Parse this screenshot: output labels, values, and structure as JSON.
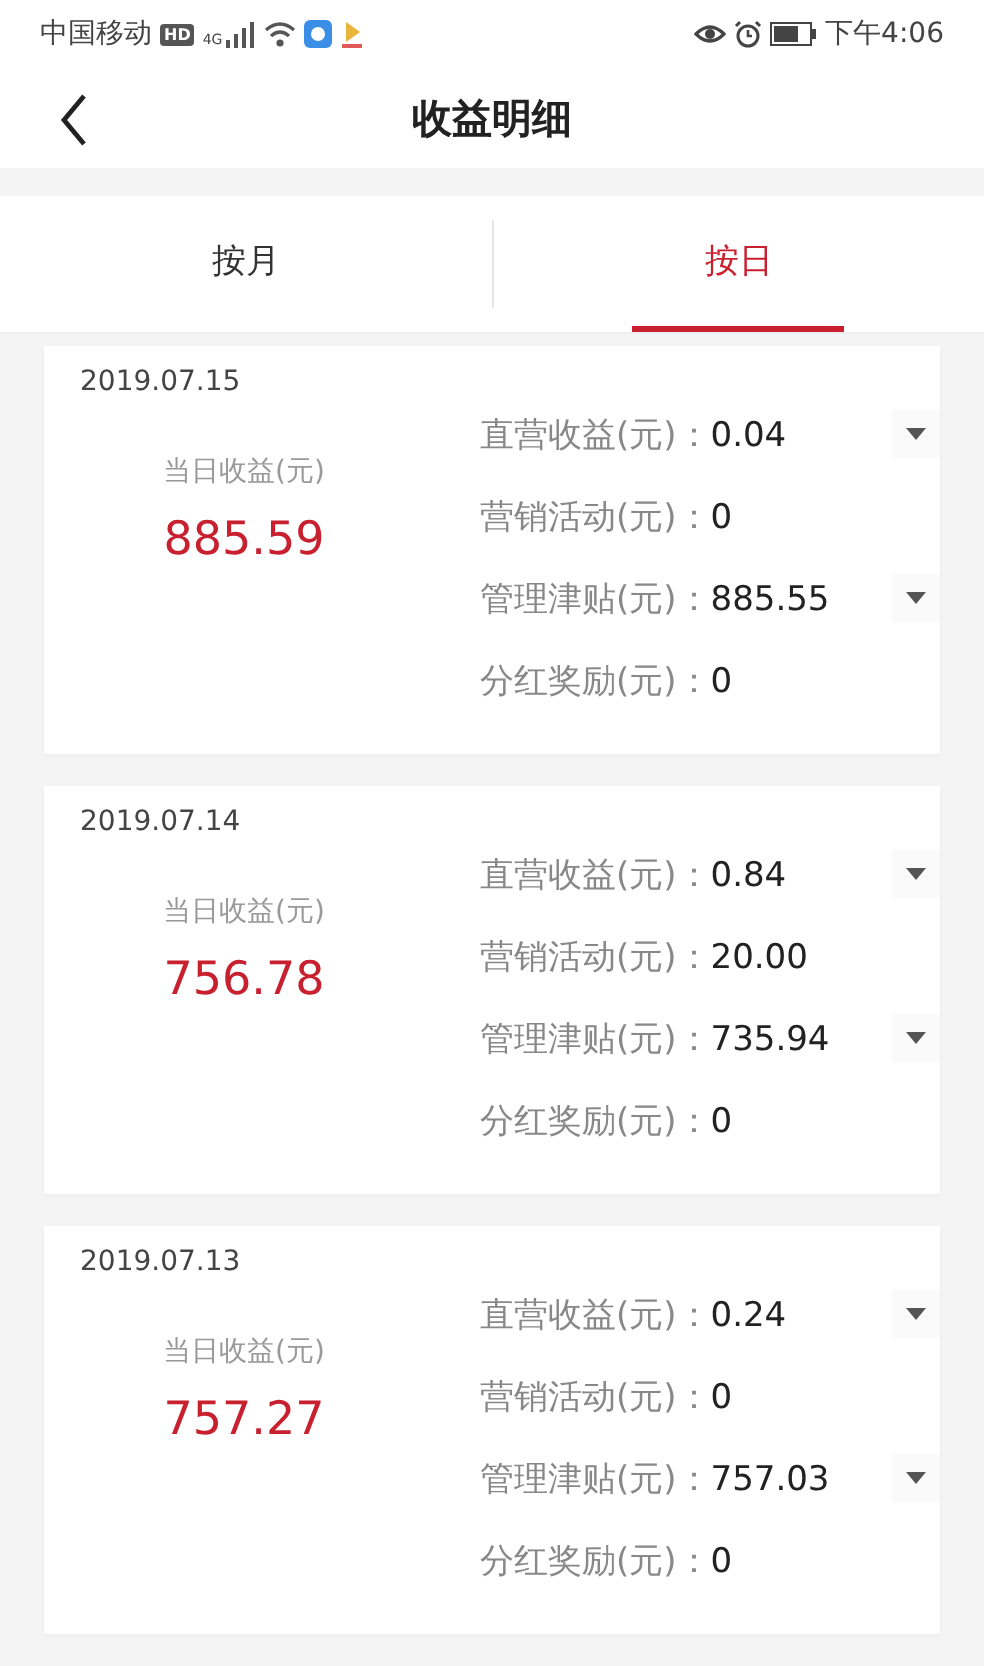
{
  "status_bar": {
    "carrier": "中国移动",
    "hd_badge": "HD",
    "network": "4G",
    "time": "下午4:06"
  },
  "header": {
    "title": "收益明细"
  },
  "tabs": [
    {
      "label": "按月",
      "selected": false
    },
    {
      "label": "按日",
      "selected": true
    }
  ],
  "records": [
    {
      "date": "2019.07.15",
      "total_label": "当日收益(元)",
      "total": "885.59",
      "rows": [
        {
          "label": "直营收益(元)：",
          "value": "0.04",
          "expandable": true
        },
        {
          "label": "营销活动(元)：",
          "value": "0",
          "expandable": false
        },
        {
          "label": "管理津贴(元)：",
          "value": "885.55",
          "expandable": true
        },
        {
          "label": "分红奖励(元)：",
          "value": "0",
          "expandable": false
        }
      ]
    },
    {
      "date": "2019.07.14",
      "total_label": "当日收益(元)",
      "total": "756.78",
      "rows": [
        {
          "label": "直营收益(元)：",
          "value": "0.84",
          "expandable": true
        },
        {
          "label": "营销活动(元)：",
          "value": "20.00",
          "expandable": false
        },
        {
          "label": "管理津贴(元)：",
          "value": "735.94",
          "expandable": true
        },
        {
          "label": "分红奖励(元)：",
          "value": "0",
          "expandable": false
        }
      ]
    },
    {
      "date": "2019.07.13",
      "total_label": "当日收益(元)",
      "total": "757.27",
      "rows": [
        {
          "label": "直营收益(元)：",
          "value": "0.24",
          "expandable": true
        },
        {
          "label": "营销活动(元)：",
          "value": "0",
          "expandable": false
        },
        {
          "label": "管理津贴(元)：",
          "value": "757.03",
          "expandable": true
        },
        {
          "label": "分红奖励(元)：",
          "value": "0",
          "expandable": false
        }
      ]
    }
  ]
}
